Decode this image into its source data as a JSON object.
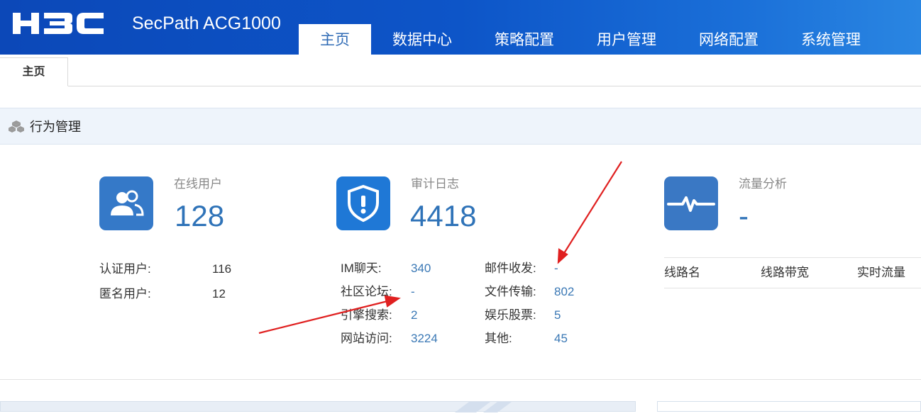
{
  "header": {
    "logo_text": "H3C",
    "product_name": "SecPath ACG1000",
    "nav": [
      "主页",
      "数据中心",
      "策略配置",
      "用户管理",
      "网络配置",
      "系统管理"
    ],
    "active_nav": "主页"
  },
  "page_tabs": [
    "主页"
  ],
  "section": {
    "title": "行为管理",
    "icon": "cubes-icon"
  },
  "online_users": {
    "label": "在线用户",
    "value": "128",
    "icon": "users-icon",
    "rows": [
      {
        "label": "认证用户:",
        "value": "116"
      },
      {
        "label": "匿名用户:",
        "value": "12"
      }
    ]
  },
  "audit_log": {
    "label": "审计日志",
    "value": "4418",
    "icon": "shield-alert-icon",
    "left_rows": [
      {
        "label": "IM聊天:",
        "value": "340"
      },
      {
        "label": "社区论坛:",
        "value": "-"
      },
      {
        "label": "引擎搜索:",
        "value": "2"
      },
      {
        "label": "网站访问:",
        "value": "3224"
      }
    ],
    "right_rows": [
      {
        "label": "邮件收发:",
        "value": "-"
      },
      {
        "label": "文件传输:",
        "value": "802"
      },
      {
        "label": "娱乐股票:",
        "value": "5"
      },
      {
        "label": "其他:",
        "value": "45"
      }
    ]
  },
  "traffic": {
    "label": "流量分析",
    "value": "-",
    "icon": "pulse-icon",
    "columns": [
      "线路名",
      "线路带宽",
      "实时流量"
    ]
  },
  "colors": {
    "header_blue": "#0d55c8",
    "tile_blue": "#3579c8",
    "value_blue": "#2f73b8",
    "annotation_red": "#e02020"
  }
}
